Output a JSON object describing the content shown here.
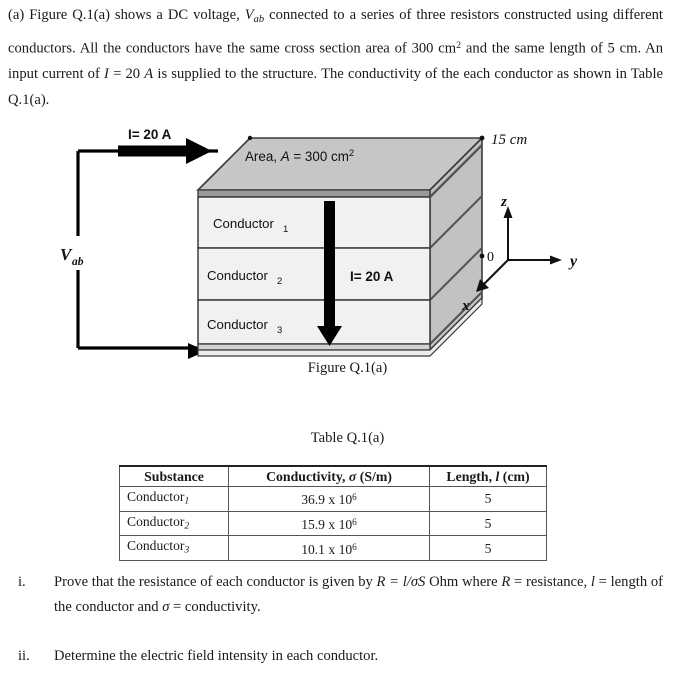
{
  "intro": {
    "part_label": "(a)",
    "text_1": "Figure Q.1(a) shows a DC voltage, ",
    "voltage_symbol": "V",
    "voltage_sub": "ab",
    "text_2": " connected to a series of three resistors constructed using different conductors. All the conductors have the same cross section area of 300 cm",
    "area_sup": "2",
    "text_3": " and the same length of 5 cm. An input current of ",
    "current_symbol": "I",
    "text_4": " = 20 ",
    "current_unit": "A",
    "text_5": " is supplied to the structure. The conductivity of the each conductor as shown in Table Q.1(a)."
  },
  "figure": {
    "caption": "Figure Q.1(a)",
    "input_current_label": "I= 20 A",
    "area_label": "Area, A = 300 cm²",
    "area_label_prefix": "Area, ",
    "area_label_symbol": "A",
    "area_label_value": " = 300 cm",
    "area_label_sup": "2",
    "height_label": "15 cm",
    "voltage_label": "V",
    "voltage_label_sub": "ab",
    "inner_current_label": "I= 20 A",
    "layers": [
      {
        "name": "Conductor",
        "sub": "1"
      },
      {
        "name": "Conductor",
        "sub": "2"
      },
      {
        "name": "Conductor",
        "sub": "3"
      }
    ],
    "axes": {
      "origin": "0",
      "x": "x",
      "y": "y",
      "z": "z"
    },
    "colors": {
      "top_face": "#c6c6c6",
      "side_face": "#c2c2c2",
      "front_face": "#f1f1f1",
      "edge": "#3b3b3b",
      "wire": "#000000"
    }
  },
  "table": {
    "caption": "Table Q.1(a)",
    "headers": {
      "substance": "Substance",
      "conductivity_prefix": "Conductivity, ",
      "conductivity_symbol": "σ",
      "conductivity_unit": " (S/m)",
      "length_prefix": "Length, ",
      "length_symbol": "l",
      "length_unit": " (cm)"
    },
    "rows": [
      {
        "substance": "Conductor",
        "substance_sub": "1",
        "conductivity": "36.9 x 10",
        "conductivity_sup": "6",
        "length": "5"
      },
      {
        "substance": "Conductor",
        "substance_sub": "2",
        "conductivity": "15.9 x 10",
        "conductivity_sup": "6",
        "length": "5"
      },
      {
        "substance": "Conductor",
        "substance_sub": "3",
        "conductivity": "10.1 x 10",
        "conductivity_sup": "6",
        "length": "5"
      }
    ]
  },
  "questions": [
    {
      "number": "i.",
      "part_a": "Prove that the resistance of each conductor is given by ",
      "formula": "R = l/σS",
      "part_b": " Ohm where ",
      "defs_1": "R",
      "defs_1_text": " = resistance, ",
      "defs_2": "l",
      "defs_2_text": " = length of the conductor and ",
      "defs_3": "σ",
      "defs_3_text": " = conductivity."
    },
    {
      "number": "ii.",
      "text": "Determine the electric field intensity in each conductor."
    }
  ]
}
